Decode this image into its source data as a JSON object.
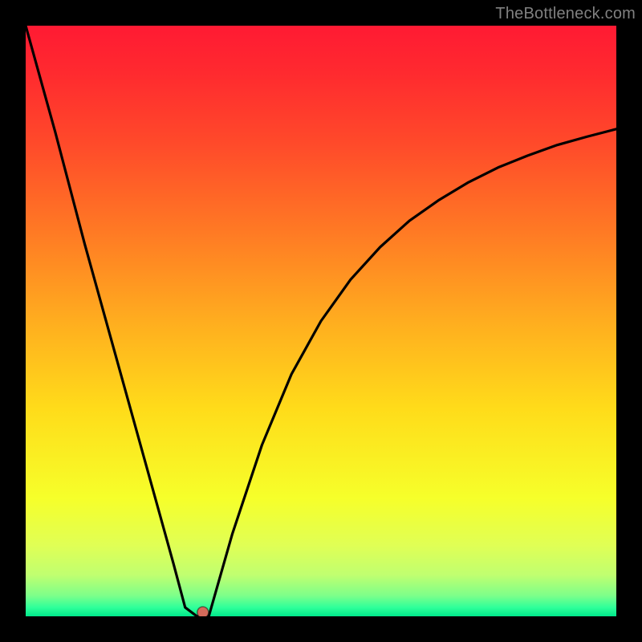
{
  "attribution": "TheBottleneck.com",
  "chart_data": {
    "type": "line",
    "title": "",
    "xlabel": "",
    "ylabel": "",
    "xlim": [
      0,
      100
    ],
    "ylim": [
      0,
      100
    ],
    "x": [
      0,
      5,
      10,
      15,
      20,
      25,
      27,
      29,
      30,
      31,
      33,
      35,
      40,
      45,
      50,
      55,
      60,
      65,
      70,
      75,
      80,
      85,
      90,
      95,
      100
    ],
    "values": [
      100,
      82,
      63,
      45,
      27,
      9,
      1.5,
      0,
      0,
      0,
      7,
      14,
      29,
      41,
      50,
      57,
      62.5,
      67,
      70.5,
      73.5,
      76,
      78,
      79.8,
      81.2,
      82.5
    ],
    "marker": {
      "x": 30,
      "y": 0
    },
    "gradient_stops": [
      {
        "offset": 0.0,
        "color": "#ff1a33"
      },
      {
        "offset": 0.08,
        "color": "#ff2a2f"
      },
      {
        "offset": 0.2,
        "color": "#ff4a2a"
      },
      {
        "offset": 0.35,
        "color": "#ff7a24"
      },
      {
        "offset": 0.5,
        "color": "#ffad1f"
      },
      {
        "offset": 0.65,
        "color": "#ffdc1a"
      },
      {
        "offset": 0.8,
        "color": "#f6ff2a"
      },
      {
        "offset": 0.88,
        "color": "#e0ff55"
      },
      {
        "offset": 0.93,
        "color": "#c0ff70"
      },
      {
        "offset": 0.965,
        "color": "#7dff8a"
      },
      {
        "offset": 0.985,
        "color": "#2fff9a"
      },
      {
        "offset": 1.0,
        "color": "#00e88b"
      }
    ]
  }
}
